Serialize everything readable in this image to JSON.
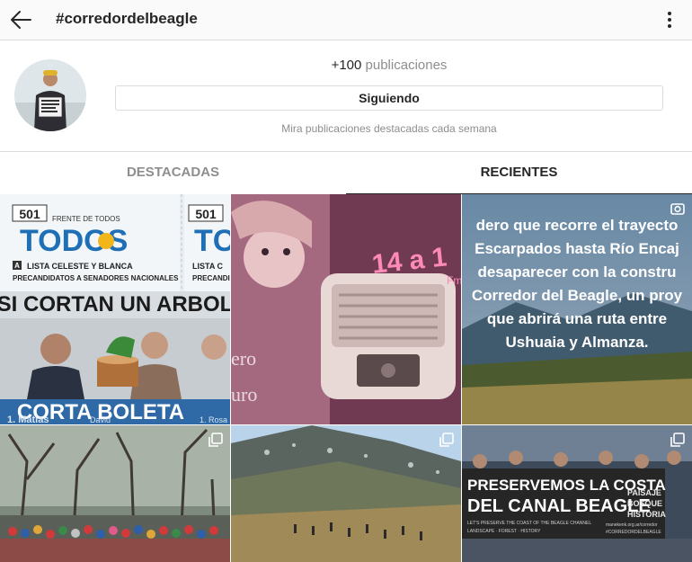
{
  "header": {
    "title": "#corredordelbeagle",
    "back_icon": "arrow-left-icon",
    "menu_icon": "more-vertical-icon"
  },
  "profile": {
    "count_value": "+100",
    "count_label": "publicaciones",
    "follow_label": "Siguiendo",
    "featured_note": "Mira publicaciones destacadas cada semana"
  },
  "tabs": [
    {
      "label": "DESTACADAS",
      "active": false
    },
    {
      "label": "RECIENTES",
      "active": true
    }
  ],
  "posts": {
    "p1": {
      "ballot_number": "501",
      "ballot_number_right": "501",
      "ballot_header": "FRENTE DE TODOS",
      "party_name": "TODOS",
      "party_name_right": "TC",
      "list_letter": "A",
      "list_name": "LISTA CELESTE Y BLANCA",
      "list_name_right": "LISTA C",
      "candidates": "PRECANDIDATOS A SENADORES NACIONALES",
      "candidates_right": "PRECANDIDATOS",
      "headline": "SI CORTAN UN ARBOL",
      "footer": "CORTA BOLETA",
      "titular": "1. Matias",
      "titular_extra": "David",
      "titular_right": "1. Rosa"
    },
    "p2": {
      "overlay_text": "14 a 1",
      "overlay_sub": "Fm",
      "side_text_1": "ero",
      "side_text_2": "uro"
    },
    "p3": {
      "lines": [
        "dero que recorre el trayecto",
        "Escarpados hasta Río Encaj",
        "desaparecer con la constru",
        "Corredor del Beagle, un proy",
        "que abrirá una ruta entre",
        "Ushuaia y Almanza."
      ]
    },
    "p6": {
      "banner_line1": "PRESERVEMOS LA COSTA",
      "banner_line2": "DEL CANAL BEAGLE",
      "banner_side": [
        "PAISAJE",
        "BOSQUE",
        "HISTORIA"
      ],
      "banner_small": "LET'S PRESERVE THE COAST OF THE BEAGLE CHANNEL",
      "banner_small2": "LANDSCAPE · FOREST · HISTORY",
      "banner_url": "manekenk.org.ar/corredor",
      "banner_tag": "#CORREDORDELBEAGLE"
    }
  },
  "colors": {
    "primary_text": "#262626",
    "secondary_text": "#8e8e8e",
    "border": "#dbdbdb"
  }
}
